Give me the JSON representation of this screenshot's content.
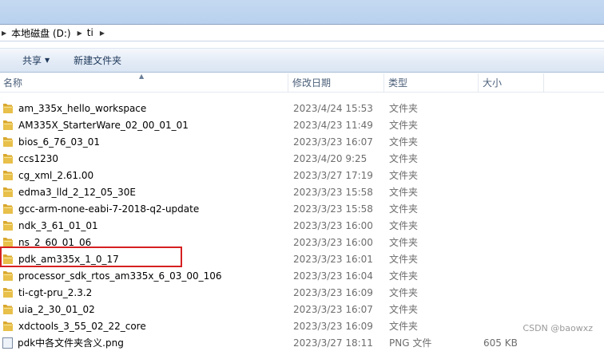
{
  "address": {
    "crumbs": [
      "本地磁盘 (D:)",
      "ti"
    ]
  },
  "toolbar": {
    "share_label": "共享",
    "new_folder_label": "新建文件夹"
  },
  "columns": {
    "name": "名称",
    "modified": "修改日期",
    "type": "类型",
    "size": "大小"
  },
  "files": [
    {
      "name": "am_335x_hello_workspace",
      "date": "2023/4/24 15:53",
      "type": "文件夹",
      "size": ""
    },
    {
      "name": "AM335X_StarterWare_02_00_01_01",
      "date": "2023/4/23 11:49",
      "type": "文件夹",
      "size": ""
    },
    {
      "name": "bios_6_76_03_01",
      "date": "2023/3/23 16:07",
      "type": "文件夹",
      "size": ""
    },
    {
      "name": "ccs1230",
      "date": "2023/4/20 9:25",
      "type": "文件夹",
      "size": ""
    },
    {
      "name": "cg_xml_2.61.00",
      "date": "2023/3/27 17:19",
      "type": "文件夹",
      "size": ""
    },
    {
      "name": "edma3_lld_2_12_05_30E",
      "date": "2023/3/23 15:58",
      "type": "文件夹",
      "size": ""
    },
    {
      "name": "gcc-arm-none-eabi-7-2018-q2-update",
      "date": "2023/3/23 15:58",
      "type": "文件夹",
      "size": ""
    },
    {
      "name": "ndk_3_61_01_01",
      "date": "2023/3/23 16:00",
      "type": "文件夹",
      "size": ""
    },
    {
      "name": "ns_2_60_01_06",
      "date": "2023/3/23 16:00",
      "type": "文件夹",
      "size": ""
    },
    {
      "name": "pdk_am335x_1_0_17",
      "date": "2023/3/23 16:01",
      "type": "文件夹",
      "size": ""
    },
    {
      "name": "processor_sdk_rtos_am335x_6_03_00_106",
      "date": "2023/3/23 16:04",
      "type": "文件夹",
      "size": ""
    },
    {
      "name": "ti-cgt-pru_2.3.2",
      "date": "2023/3/23 16:09",
      "type": "文件夹",
      "size": ""
    },
    {
      "name": "uia_2_30_01_02",
      "date": "2023/3/23 16:07",
      "type": "文件夹",
      "size": ""
    },
    {
      "name": "xdctools_3_55_02_22_core",
      "date": "2023/3/23 16:09",
      "type": "文件夹",
      "size": ""
    },
    {
      "name": "pdk中各文件夹含义.png",
      "date": "2023/3/27 18:11",
      "type": "PNG 文件",
      "size": "605 KB"
    }
  ],
  "watermark": "CSDN @baowxz",
  "colors": {
    "folder": "#e8c04a",
    "highlight": "#d62020",
    "toolbar_text": "#1e395b"
  }
}
